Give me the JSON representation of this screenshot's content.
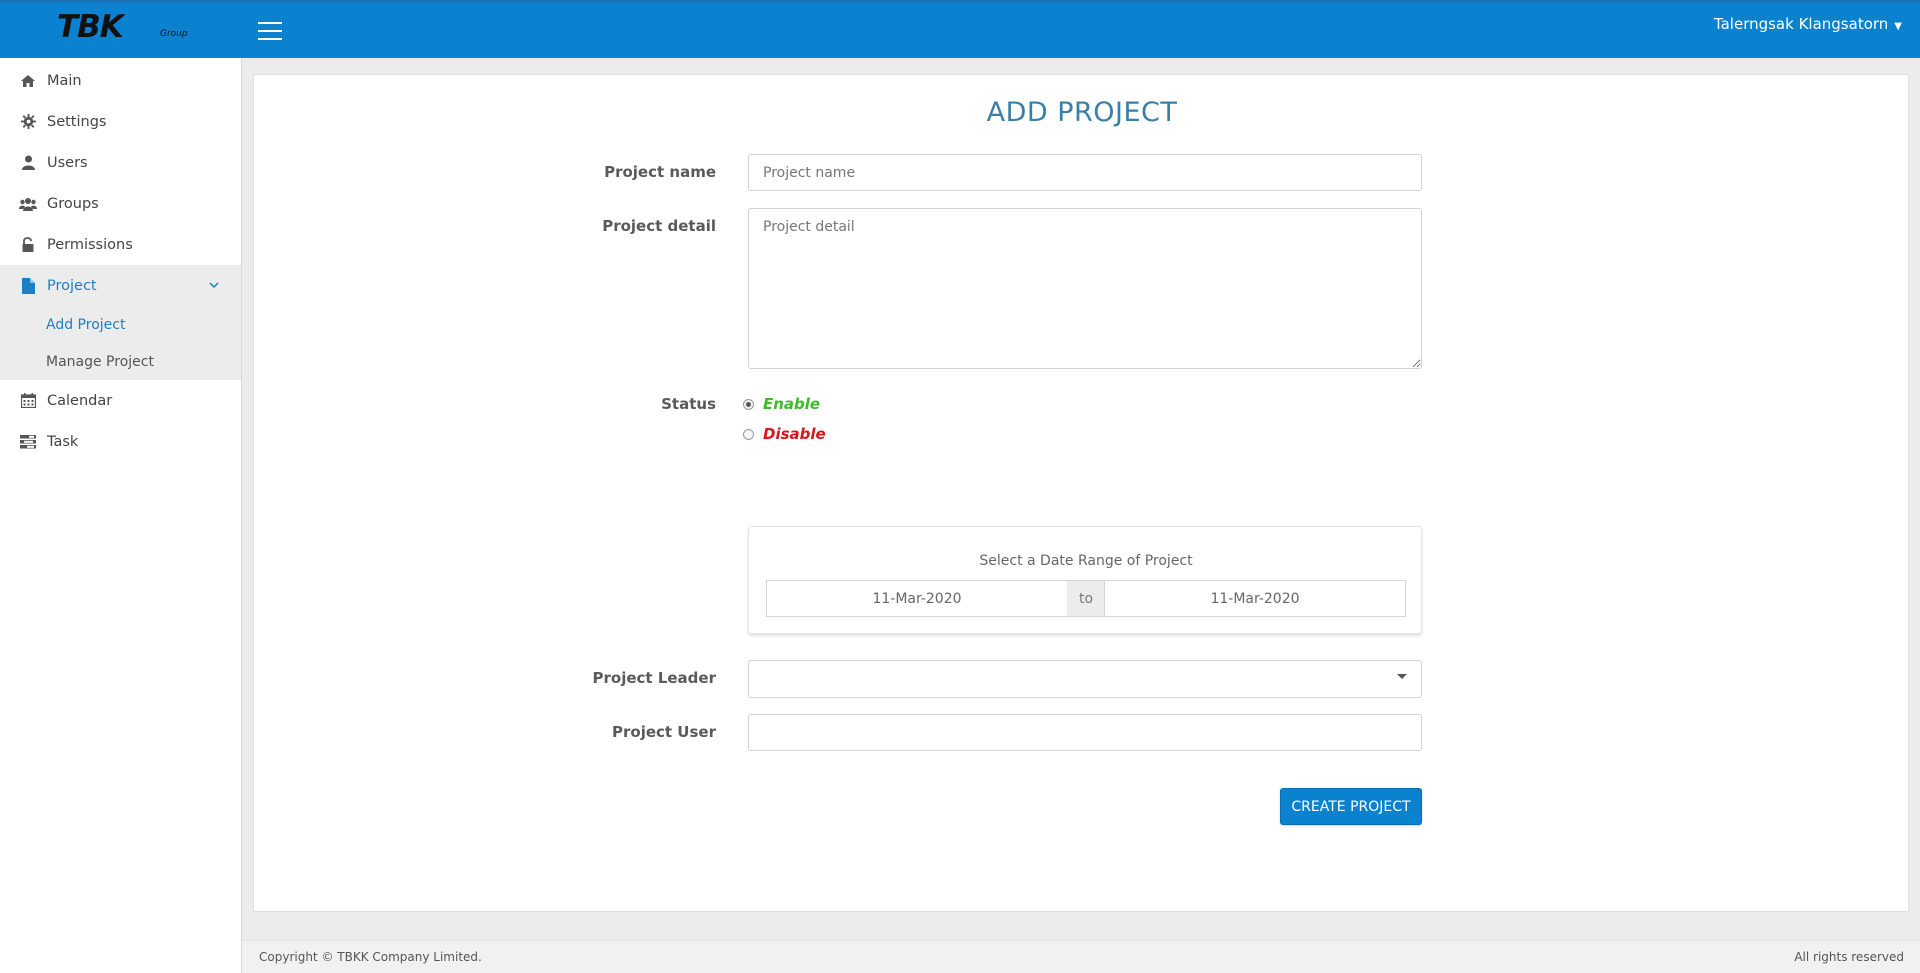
{
  "brand": {
    "logo_text": "TBK",
    "logo_sub": "Group"
  },
  "header": {
    "user_name": "Talerngsak Klangsatorn"
  },
  "sidebar": {
    "items": [
      {
        "label": "Main",
        "icon": "home-icon"
      },
      {
        "label": "Settings",
        "icon": "gear-icon"
      },
      {
        "label": "Users",
        "icon": "user-icon"
      },
      {
        "label": "Groups",
        "icon": "users-icon"
      },
      {
        "label": "Permissions",
        "icon": "unlock-icon"
      },
      {
        "label": "Project",
        "icon": "file-icon",
        "expanded": true
      },
      {
        "label": "Calendar",
        "icon": "calendar-icon"
      },
      {
        "label": "Task",
        "icon": "tasks-icon"
      }
    ],
    "project_submenu": [
      {
        "label": "Add Project",
        "active": true
      },
      {
        "label": "Manage Project"
      }
    ]
  },
  "form": {
    "title": "ADD PROJECT",
    "project_name_label": "Project name",
    "project_name_placeholder": "Project name",
    "project_detail_label": "Project detail",
    "project_detail_placeholder": "Project detail",
    "status_label": "Status",
    "status_options": [
      {
        "label": "Enable",
        "color": "#3dbb2c",
        "checked": true
      },
      {
        "label": "Disable",
        "color": "#d9141a",
        "checked": false
      }
    ],
    "date_range_title": "Select a Date Range of Project",
    "date_from": "11-Mar-2020",
    "date_to_label": "to",
    "date_to": "11-Mar-2020",
    "project_leader_label": "Project Leader",
    "project_leader_value": "",
    "project_user_label": "Project User",
    "project_user_value": "",
    "submit_label": "CREATE PROJECT"
  },
  "footer": {
    "copyright": "Copyright © TBKK Company Limited.",
    "rights": "All rights reserved"
  },
  "colors": {
    "accent": "#0a82cf",
    "title": "#3a7fa6"
  }
}
